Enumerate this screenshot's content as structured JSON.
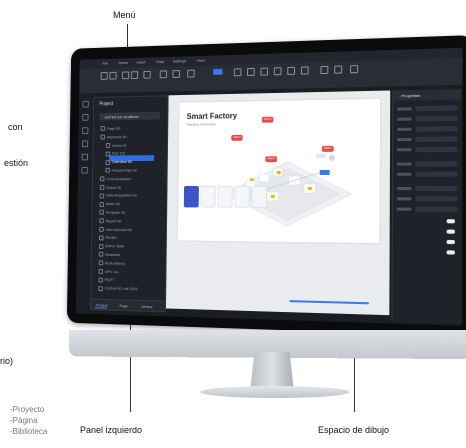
{
  "annotations": {
    "menu_label": "Menú",
    "left_panel_label": "Panel izquierdo",
    "drawing_space_label": "Espacio de dibujo",
    "left_partial_1": "con",
    "left_partial_2": "estión",
    "left_partial_3": "rio)",
    "bottom_list": [
      "-Proyecto",
      "-Página",
      "-Biblioteca"
    ]
  },
  "app": {
    "window_tabs": [
      "File",
      "Home",
      "Insert",
      "Data",
      "Settings",
      "View"
    ],
    "left_panel": {
      "title": "Project",
      "search_value": "SUPER Air conditione",
      "items": [
        "Page 00",
        "Welcome 00",
        "Home 01",
        "Part 112",
        "Overview 00",
        "Fenced Flap 00",
        "Communication",
        "Scada 00",
        "Data Acquisition 00",
        "Alarm 00",
        "Template 00",
        "Report 00",
        "User Account 00",
        "Recipe",
        "Active Table",
        "Database",
        "Redundancy",
        "OPC UA",
        "MQTT",
        "Custom IO Lab 2022"
      ],
      "bottom_tabs": [
        "Project",
        "Page",
        "Library"
      ]
    },
    "canvas": {
      "page_title": "Smart Factory",
      "page_subtitle": "Factory Overview",
      "alerts": [
        "Alarm",
        "Alarm",
        "Alarm",
        "Alarm"
      ]
    },
    "right_panel": {
      "header": "Properties"
    }
  },
  "colors": {
    "accent": "#3a78f2",
    "alert": "#e84b4b",
    "ide_bg": "#1a1d24"
  }
}
